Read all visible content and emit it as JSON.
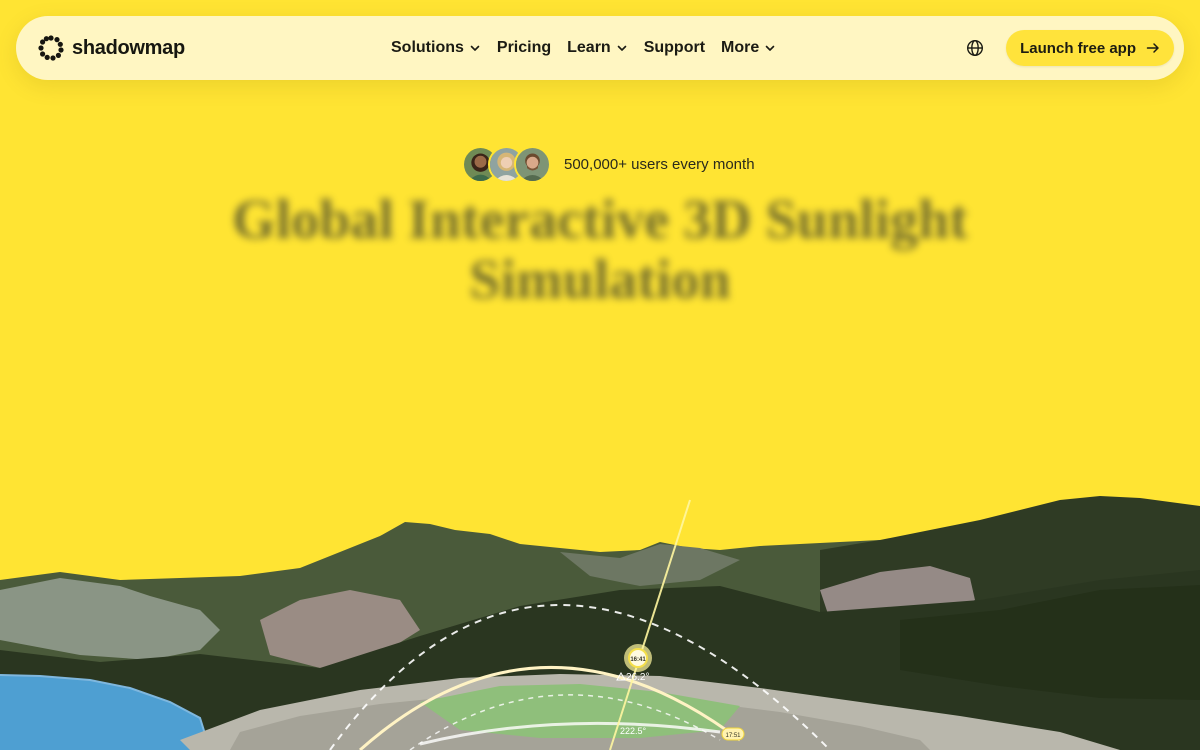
{
  "nav": {
    "brand": "shadowmap",
    "menu": [
      {
        "label": "Solutions",
        "has_dropdown": true
      },
      {
        "label": "Pricing",
        "has_dropdown": false
      },
      {
        "label": "Learn",
        "has_dropdown": true
      },
      {
        "label": "Support",
        "has_dropdown": false
      },
      {
        "label": "More",
        "has_dropdown": true
      }
    ],
    "language_icon": "globe-icon",
    "cta_label": "Launch free app"
  },
  "hero": {
    "social_proof": "500,000+ users every month",
    "title": "Global Interactive 3D Sunlight Simulation"
  },
  "scene": {
    "sun_time": "16:41",
    "sun_elevation": "26.2°",
    "sun_azimuth": "222.5°",
    "sunset_time": "17:51"
  },
  "colors": {
    "background": "#FFE433",
    "nav_background": "#FFF6C2",
    "cta": "#FFE33B",
    "forest": "#2e3a22",
    "lake": "#4e9fd2"
  }
}
